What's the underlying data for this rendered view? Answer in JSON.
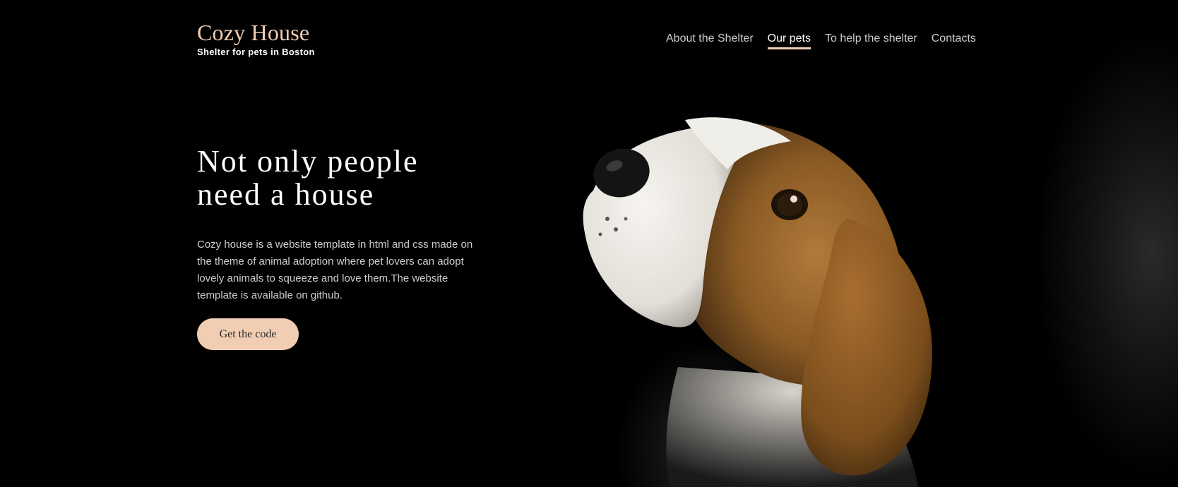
{
  "header": {
    "logo_title": "Cozy House",
    "logo_subtitle": "Shelter for pets in Boston",
    "nav": [
      {
        "label": "About the Shelter",
        "active": false
      },
      {
        "label": "Our pets",
        "active": true
      },
      {
        "label": "To help the shelter",
        "active": false
      },
      {
        "label": "Contacts",
        "active": false
      }
    ]
  },
  "hero": {
    "title_line1": "Not only people",
    "title_line2": "need a house",
    "description": "Cozy house is a website template in html and css made on the theme of animal adoption where pet lovers can adopt lovely animals to squeeze and love them.The website template is available on github.",
    "button_label": "Get the code"
  },
  "colors": {
    "accent": "#f1cdb3",
    "background": "#000000",
    "text_light": "#cdcdcd"
  }
}
